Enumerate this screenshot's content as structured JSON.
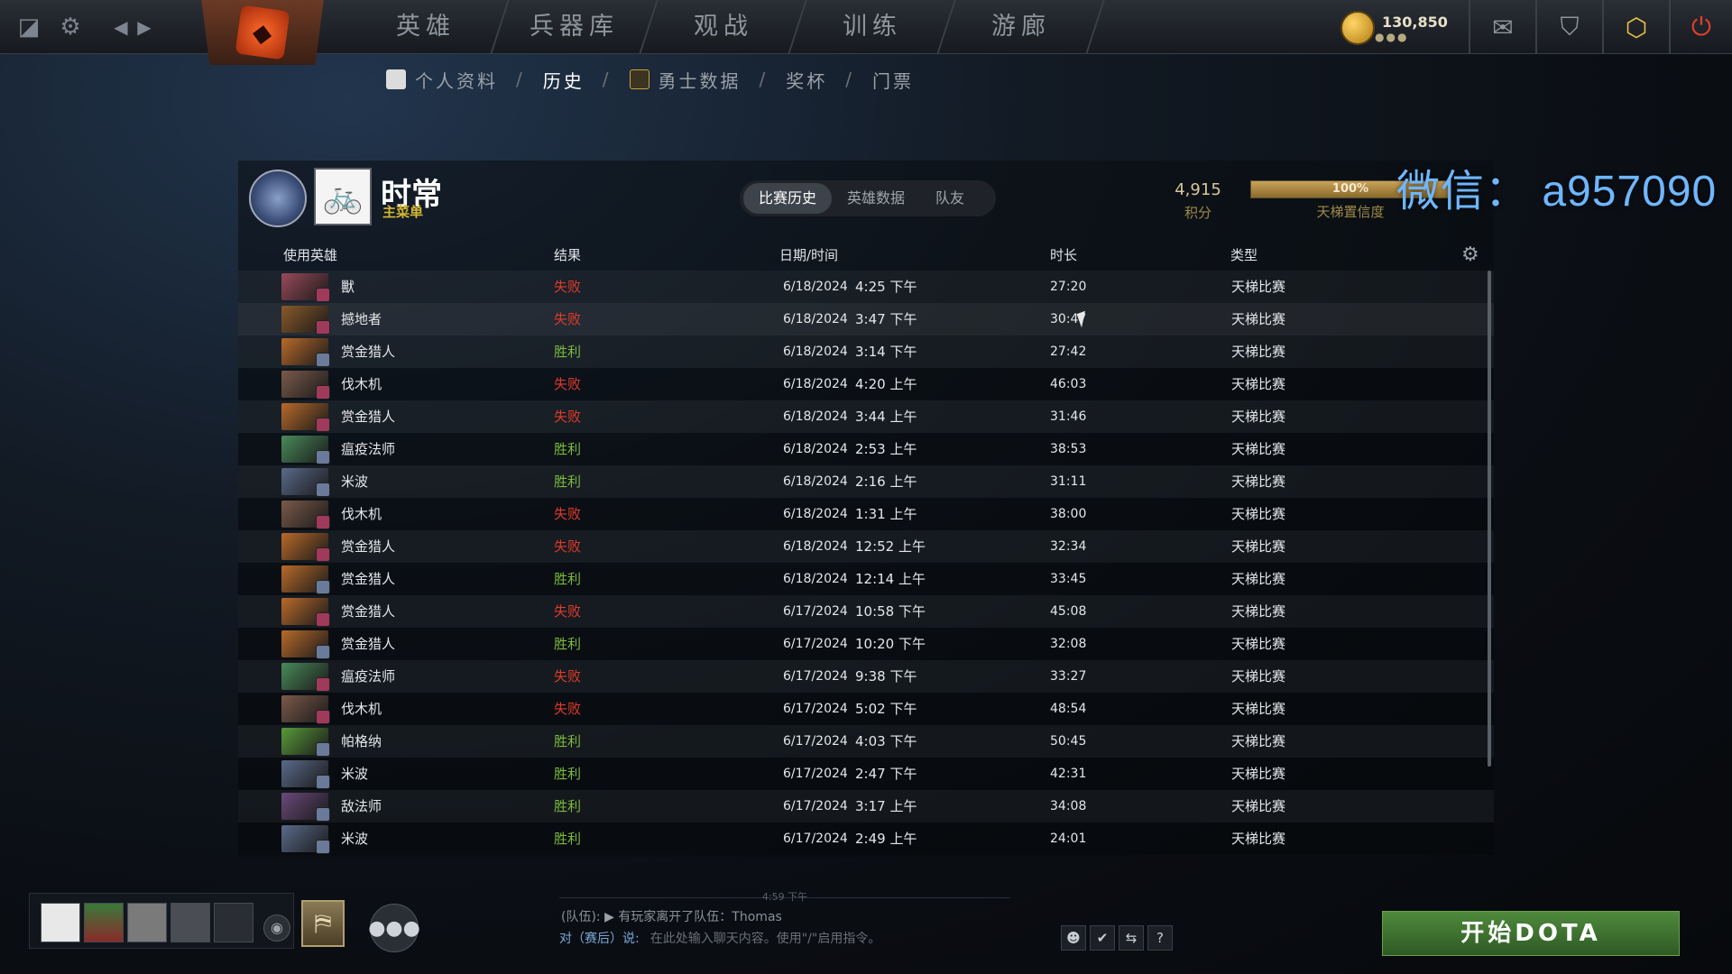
{
  "topbar": {
    "nav": [
      "英雄",
      "兵器库",
      "观战",
      "训练",
      "游廊"
    ],
    "currency": {
      "amount": "130,850",
      "dots": "●●●"
    },
    "accent": "#ff6a2a"
  },
  "subnav": {
    "items": [
      {
        "label": "个人资料",
        "active": false
      },
      {
        "label": "历史",
        "active": true
      },
      {
        "label": "勇士数据",
        "active": false
      },
      {
        "label": "奖杯",
        "active": false
      },
      {
        "label": "门票",
        "active": false
      }
    ],
    "separator": "/"
  },
  "profile": {
    "name": "时常",
    "status": "主菜单",
    "tabs": [
      "比赛历史",
      "英雄数据",
      "队友"
    ],
    "active_tab": 0,
    "score_value": "4,915",
    "score_label": "积分",
    "confidence_pct": "100%",
    "confidence_fraction": 1.0,
    "confidence_label": "天梯置信度"
  },
  "watermark": "微信：  a957090",
  "table": {
    "headers": {
      "hero": "使用英雄",
      "result": "结果",
      "datetime": "日期/时间",
      "duration": "时长",
      "type": "类型"
    },
    "rows": [
      {
        "hero": "獸",
        "result": "失败",
        "win": false,
        "date": "6/18/2024",
        "time": "4:25 下午",
        "duration": "27:20",
        "type": "天梯比赛",
        "color": "#9a4a5a"
      },
      {
        "hero": "撼地者",
        "result": "失败",
        "win": false,
        "date": "6/18/2024",
        "time": "3:47 下午",
        "duration": "30:47",
        "type": "天梯比赛",
        "color": "#8a5a2a"
      },
      {
        "hero": "赏金猎人",
        "result": "胜利",
        "win": true,
        "date": "6/18/2024",
        "time": "3:14 下午",
        "duration": "27:42",
        "type": "天梯比赛",
        "color": "#b86a2a"
      },
      {
        "hero": "伐木机",
        "result": "失败",
        "win": false,
        "date": "6/18/2024",
        "time": "4:20 上午",
        "duration": "46:03",
        "type": "天梯比赛",
        "color": "#7a5a4a"
      },
      {
        "hero": "赏金猎人",
        "result": "失败",
        "win": false,
        "date": "6/18/2024",
        "time": "3:44 上午",
        "duration": "31:46",
        "type": "天梯比赛",
        "color": "#b86a2a"
      },
      {
        "hero": "瘟疫法师",
        "result": "胜利",
        "win": true,
        "date": "6/18/2024",
        "time": "2:53 上午",
        "duration": "38:53",
        "type": "天梯比赛",
        "color": "#4a8a5a"
      },
      {
        "hero": "米波",
        "result": "胜利",
        "win": true,
        "date": "6/18/2024",
        "time": "2:16 上午",
        "duration": "31:11",
        "type": "天梯比赛",
        "color": "#5a6a8a"
      },
      {
        "hero": "伐木机",
        "result": "失败",
        "win": false,
        "date": "6/18/2024",
        "time": "1:31 上午",
        "duration": "38:00",
        "type": "天梯比赛",
        "color": "#7a5a4a"
      },
      {
        "hero": "赏金猎人",
        "result": "失败",
        "win": false,
        "date": "6/18/2024",
        "time": "12:52 上午",
        "duration": "32:34",
        "type": "天梯比赛",
        "color": "#b86a2a"
      },
      {
        "hero": "赏金猎人",
        "result": "胜利",
        "win": true,
        "date": "6/18/2024",
        "time": "12:14 上午",
        "duration": "33:45",
        "type": "天梯比赛",
        "color": "#b86a2a"
      },
      {
        "hero": "赏金猎人",
        "result": "失败",
        "win": false,
        "date": "6/17/2024",
        "time": "10:58 下午",
        "duration": "45:08",
        "type": "天梯比赛",
        "color": "#b86a2a"
      },
      {
        "hero": "赏金猎人",
        "result": "胜利",
        "win": true,
        "date": "6/17/2024",
        "time": "10:20 下午",
        "duration": "32:08",
        "type": "天梯比赛",
        "color": "#b86a2a"
      },
      {
        "hero": "瘟疫法师",
        "result": "失败",
        "win": false,
        "date": "6/17/2024",
        "time": "9:38 下午",
        "duration": "33:27",
        "type": "天梯比赛",
        "color": "#4a8a5a"
      },
      {
        "hero": "伐木机",
        "result": "失败",
        "win": false,
        "date": "6/17/2024",
        "time": "5:02 下午",
        "duration": "48:54",
        "type": "天梯比赛",
        "color": "#7a5a4a"
      },
      {
        "hero": "帕格纳",
        "result": "胜利",
        "win": true,
        "date": "6/17/2024",
        "time": "4:03 下午",
        "duration": "50:45",
        "type": "天梯比赛",
        "color": "#5a9a3a"
      },
      {
        "hero": "米波",
        "result": "胜利",
        "win": true,
        "date": "6/17/2024",
        "time": "2:47 下午",
        "duration": "42:31",
        "type": "天梯比赛",
        "color": "#5a6a8a"
      },
      {
        "hero": "敌法师",
        "result": "胜利",
        "win": true,
        "date": "6/17/2024",
        "time": "3:17 上午",
        "duration": "34:08",
        "type": "天梯比赛",
        "color": "#6a4a7a"
      },
      {
        "hero": "米波",
        "result": "胜利",
        "win": true,
        "date": "6/17/2024",
        "time": "2:49 上午",
        "duration": "24:01",
        "type": "天梯比赛",
        "color": "#5a6a8a"
      }
    ]
  },
  "chat": {
    "timestamp": "4:59 下午",
    "channel": "(队伍):",
    "message": "有玩家离开了队伍：Thomas",
    "target": "对（赛后）说:",
    "placeholder": "在此处输入聊天内容。使用\"/\"启用指令。",
    "tools": [
      "☻",
      "✔",
      "⇆",
      "?"
    ]
  },
  "play_button": "开始DOTA"
}
